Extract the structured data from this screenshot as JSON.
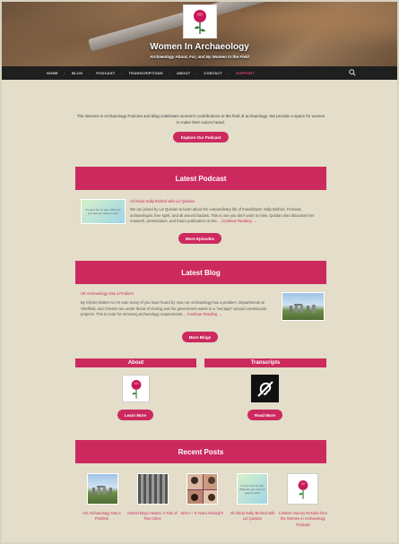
{
  "header": {
    "site_title": "Women In Archaeology",
    "tagline": "Archaeology About, For, and By Women in the Field"
  },
  "nav": {
    "items": [
      {
        "label": "HOME"
      },
      {
        "label": "BLOG"
      },
      {
        "label": "PODCAST"
      },
      {
        "label": "TRANSCRIPTIONS"
      },
      {
        "label": "ABOUT"
      },
      {
        "label": "CONTACT"
      },
      {
        "label": "SUPPORT"
      }
    ],
    "active": "SUPPORT",
    "search_icon": "search-icon"
  },
  "intro": {
    "text": "The Women In Archaeology Podcast and Blog celebrates women's contributions to the field of archaeology. We provide a space for women to make their voices heard.",
    "button": "Explore Our Podcast"
  },
  "latest_podcast": {
    "heading": "Latest Podcast",
    "post_title": "All About Sally Binford with Liz Quinlan",
    "excerpt": "We are joined by Liz Quinlan to learn about the extraordinary life of trowelblazer Sally Binford. Feminist, archaeologist, free spirit, and all around badass. This is one you don't want to miss. Quinlan also discusses her research, presentation, and future publication on the…",
    "more_link": "Continue Reading →",
    "thumb_text": "It's your turn to ask, What are you ask you want to see?",
    "button": "More Episodes"
  },
  "latest_blog": {
    "heading": "Latest Blog",
    "post_title": "UK Archaeology Has a Problem",
    "excerpt": "By Chelsi Slotten As I'm sure many of you have heard by now, UK archaeology has a problem. Departments at Sheffield, and Chester are under threat of closing and the government wants to a \"red tape\" around construction projects. This is code for removing archaeology requirements…",
    "more_link": "Continue Reading →",
    "button": "More Blogs"
  },
  "about": {
    "heading": "About",
    "button": "Learn More"
  },
  "transcripts": {
    "heading": "Transcripts",
    "button": "Read More",
    "icon": "hearing-impaired-icon"
  },
  "recent_posts": {
    "heading": "Recent Posts",
    "items": [
      {
        "title": "UK Archaeology Has a Problem"
      },
      {
        "title": "Harriet Boyd Hawes: A Tale of Two Cities"
      },
      {
        "title": "WIAA – 5 Years Already?!"
      },
      {
        "title": "All About Sally Binford with Liz Quinlan"
      },
      {
        "title": "Listener Survey Results from the Women in Archaeology Podcast"
      }
    ],
    "thumb4_text": "It's your turn to ask, What are you ask you want to see?"
  },
  "colors": {
    "accent": "#cc2a5e",
    "background": "#e3ddc9",
    "nav": "#1f1f1f"
  }
}
